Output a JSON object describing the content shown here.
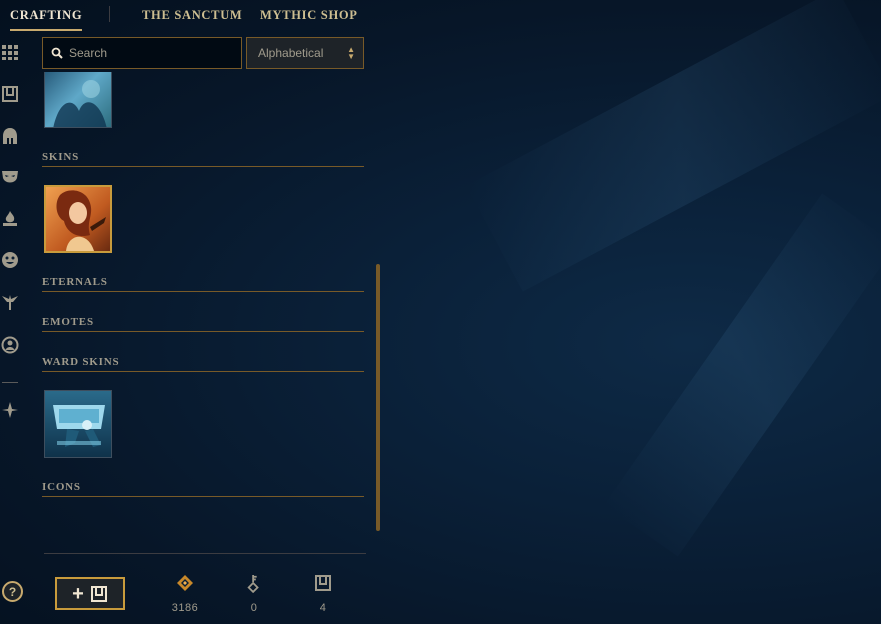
{
  "nav": {
    "tabs": [
      {
        "label": "CRAFTING",
        "active": true
      },
      {
        "label": "THE SANCTUM",
        "active": false
      },
      {
        "label": "MYTHIC SHOP",
        "active": false
      }
    ]
  },
  "rail": {
    "icons": [
      "grid-icon",
      "chest-icon",
      "champion-helmet-icon",
      "skin-mask-icon",
      "emote-flame-icon",
      "emote-face-icon",
      "ward-icon",
      "profile-icon-icon",
      "eternals-icon"
    ],
    "help_label": "?"
  },
  "search": {
    "placeholder": "Search",
    "value": ""
  },
  "sort": {
    "selected": "Alphabetical"
  },
  "sections": {
    "skins": "SKINS",
    "eternals": "ETERNALS",
    "emotes": "EMOTES",
    "ward_skins": "WARD SKINS",
    "icons": "ICONS"
  },
  "currencies": [
    {
      "icon": "blue-essence-icon",
      "value": "3186"
    },
    {
      "icon": "key-icon",
      "value": "0"
    },
    {
      "icon": "chest-icon",
      "value": "4"
    }
  ],
  "colors": {
    "gold": "#c8aa6e",
    "gold_dark": "#785a28",
    "text": "#a09b8c",
    "background": "#0a1e33"
  }
}
